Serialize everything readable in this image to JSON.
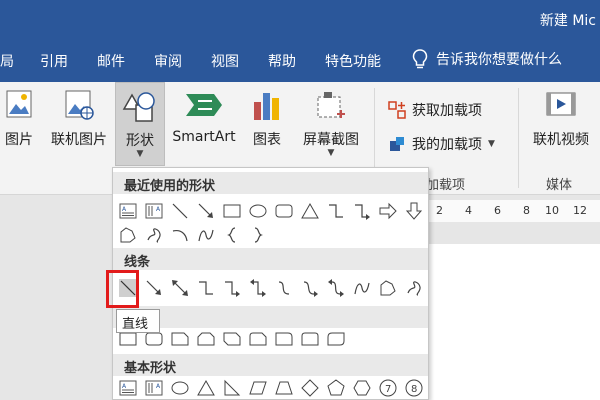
{
  "window": {
    "title": "新建 Mic"
  },
  "menu": {
    "tabs": [
      "局",
      "引用",
      "邮件",
      "审阅",
      "视图",
      "帮助",
      "特色功能"
    ],
    "tell_me": "告诉我你想要做什么"
  },
  "ribbon": {
    "picture": "图片",
    "online_picture": "联机图片",
    "shapes": "形状",
    "smartart": "SmartArt",
    "chart": "图表",
    "screenshot": "屏幕截图",
    "get_addins": "获取加载项",
    "my_addins": "我的加载项",
    "addins_group": "加载项",
    "online_video": "联机视频",
    "media_group": "媒体"
  },
  "ruler": {
    "ticks": [
      "2",
      "4",
      "6",
      "8",
      "10",
      "12"
    ]
  },
  "dropdown": {
    "recent_header": "最近使用的形状",
    "lines_header": "线条",
    "basic_header": "基本形状",
    "tooltip": "直线"
  },
  "colors": {
    "accent": "#2b579a",
    "highlight": "#e21b1b"
  }
}
